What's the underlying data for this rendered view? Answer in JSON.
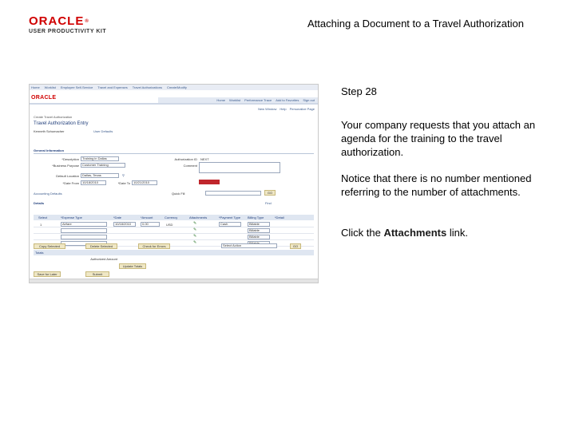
{
  "brand": {
    "logo_text": "ORACLE",
    "logo_subtitle": "USER PRODUCTIVITY KIT"
  },
  "page_title": "Attaching a Document to a Travel Authorization",
  "screenshot": {
    "nav_links": [
      "Home",
      "Worklist",
      "Employee Self-Service",
      "Travel and Expenses",
      "Travel Authorizations",
      "Create/Modify"
    ],
    "oracle_mini": "ORACLE",
    "top_menu": [
      "Home",
      "Worklist",
      "Performance Trace",
      "Add to Favorites",
      "Sign out"
    ],
    "header_links": [
      "New Window",
      "Help",
      "Personalize Page"
    ],
    "breadcrumb": "Create Travel Authorization",
    "title": "Travel Authorization Entry",
    "employee_name": "Kenneth Schumacher",
    "user_defaults": "User Defaults",
    "section_title": "General Information",
    "fields": {
      "description_label": "*Description",
      "description_value": "Training in Dallas",
      "business_purpose_label": "*Business Purpose",
      "business_purpose_value": "Customer Training",
      "authorization_id_label": "Authorization ID",
      "authorization_id_value": "NEXT",
      "comment_label": "Comment",
      "default_location_label": "Default Location",
      "default_location_value": "Dallas, Texas",
      "date_from_label": "*Date From",
      "date_from_value": "10/18/2010",
      "date_to_label": "*Date To",
      "date_to_value": "10/21/2010"
    },
    "accounting_defaults": "Accounting Defaults",
    "quick_fill": "Quick Fill",
    "grid": {
      "title": "Details",
      "find": "Find",
      "headers": [
        "Select",
        "*Expense Type",
        "*Date",
        "*Amount",
        "Currency",
        "Attachments",
        "*Payment Type",
        "Billing Type",
        "*Detail"
      ],
      "rows": [
        {
          "select": "1",
          "expense_type": "Airfare",
          "date": "10/18/2010",
          "amount": "0.00",
          "currency": "USD",
          "payment": "Cash",
          "billing": "Billable"
        },
        {
          "select": "",
          "expense_type": "",
          "date": "",
          "amount": "",
          "currency": "",
          "payment": "",
          "billing": "Billable"
        },
        {
          "select": "",
          "expense_type": "",
          "date": "",
          "amount": "",
          "currency": "",
          "payment": "",
          "billing": "Billable"
        },
        {
          "select": "",
          "expense_type": "",
          "date": "",
          "amount": "",
          "currency": "",
          "payment": "",
          "billing": "Billable"
        }
      ]
    },
    "buttons": {
      "copy_selected": "Copy Selected",
      "delete_selected": "Delete Selected",
      "check_for_errors": "Check for Errors",
      "action_select": "Select Action",
      "go": "GO",
      "update_totals": "Update Totals",
      "save_for_later": "Save for Later",
      "submit": "Submit"
    },
    "totals_title": "Totals",
    "authorized_amount_label": "Authorized Amount"
  },
  "instructions": {
    "step": "Step 28",
    "para1": "Your company requests that you attach an agenda for the training to the travel authorization.",
    "para2": "Notice that there is no number mentioned referring to the number of attachments.",
    "para3_prefix": "Click the ",
    "para3_link": "Attachments",
    "para3_suffix": " link."
  }
}
